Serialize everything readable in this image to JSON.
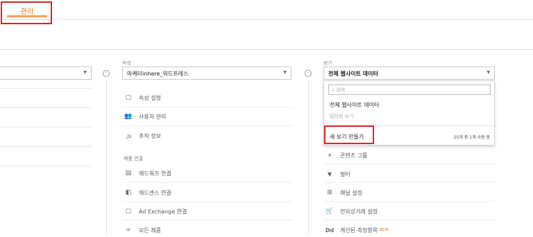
{
  "header": {
    "tab_admin": "관리"
  },
  "property": {
    "label": "속성",
    "selected": "마케터inhere_워드프레스",
    "menu": [
      {
        "icon": "property-settings-icon",
        "glyph": "▢",
        "label": "속성 설정"
      },
      {
        "icon": "users-icon",
        "glyph": "👥",
        "label": "사용자 관리"
      },
      {
        "icon": "js-icon",
        "glyph": ".js",
        "label": "추적 정보"
      }
    ],
    "section": "제품 연결",
    "product_links": [
      {
        "icon": "adwords-icon",
        "glyph": "▤",
        "label": "애드워즈 연결"
      },
      {
        "icon": "adsense-icon",
        "glyph": "◧",
        "label": "애드센스 연결"
      },
      {
        "icon": "ad-exchange-icon",
        "glyph": "▢",
        "label": "Ad Exchange 연결"
      },
      {
        "icon": "all-products-icon",
        "glyph": "∞",
        "label": "모든 제품"
      }
    ]
  },
  "view": {
    "label": "보기",
    "selected": "전체 웹사이트 데이터",
    "dropdown": {
      "search_placeholder": "검색",
      "option": "전체 웹사이트 데이터",
      "filter_label": "필터링 보기",
      "new_view": "새 보기 만들기",
      "count": "25개 중 1개 사용 중"
    },
    "menu": [
      {
        "icon": "content-grouping-icon",
        "glyph": "⩚",
        "label": "콘텐츠 그룹"
      },
      {
        "icon": "filter-icon",
        "glyph": "▼",
        "label": "필터"
      },
      {
        "icon": "channel-settings-icon",
        "glyph": "⊞",
        "label": "채널 설정"
      },
      {
        "icon": "ecommerce-icon",
        "glyph": "🛒",
        "label": "전자상거래 설정"
      },
      {
        "icon": "calculated-metrics-icon",
        "glyph": "Dd",
        "label": "계산된 측정항목",
        "badge": "BETA"
      }
    ]
  },
  "colors": {
    "accent": "#e8710a",
    "highlight": "#e02020"
  }
}
